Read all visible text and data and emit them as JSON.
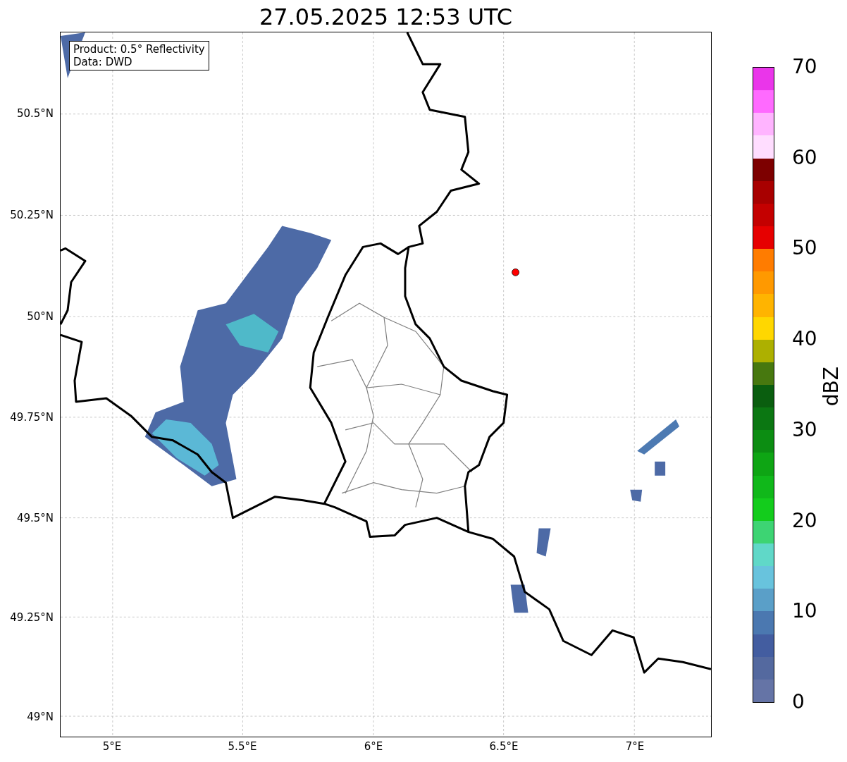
{
  "title": "27.05.2025 12:53 UTC",
  "legend": [
    "Product: 0.5° Reflectivity",
    "Data: DWD"
  ],
  "lat_ticks": [
    "50.5°N",
    "50.25°N",
    "50°N",
    "49.75°N",
    "49.5°N",
    "49.25°N",
    "49°N"
  ],
  "lon_ticks": [
    "5°E",
    "5.5°E",
    "6°E",
    "6.5°E",
    "7°E"
  ],
  "colorbar": {
    "label": "dBZ",
    "ticks": [
      "70",
      "60",
      "50",
      "40",
      "30",
      "20",
      "10",
      "0"
    ]
  }
}
